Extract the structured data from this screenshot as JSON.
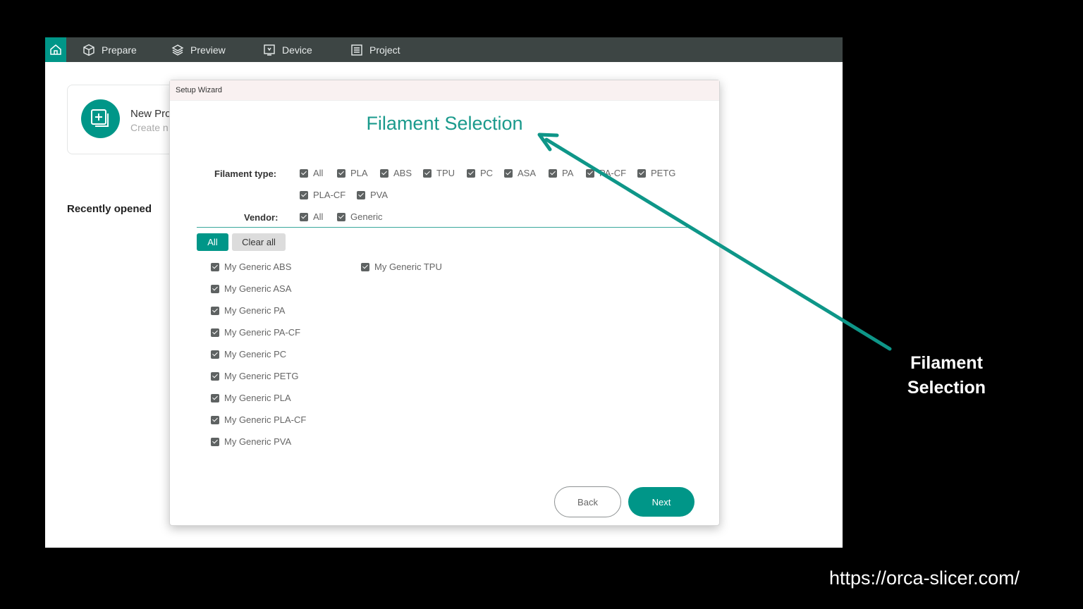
{
  "nav": {
    "tabs": [
      {
        "label": "Prepare",
        "icon": "cube-icon"
      },
      {
        "label": "Preview",
        "icon": "layers-icon"
      },
      {
        "label": "Device",
        "icon": "monitor-icon"
      },
      {
        "label": "Project",
        "icon": "list-icon"
      }
    ]
  },
  "home": {
    "new_project_title": "New Pro",
    "new_project_sub": "Create n",
    "recently_opened": "Recently opened"
  },
  "wizard": {
    "window_title": "Setup Wizard",
    "heading": "Filament Selection",
    "filament_type_label": "Filament type:",
    "filament_types": [
      "All",
      "PLA",
      "ABS",
      "TPU",
      "PC",
      "ASA",
      "PA",
      "PA-CF",
      "PETG",
      "PLA-CF",
      "PVA"
    ],
    "vendor_label": "Vendor:",
    "vendors": [
      "All",
      "Generic"
    ],
    "all_button": "All",
    "clear_all_button": "Clear all",
    "filaments_col1": [
      "My Generic ABS",
      "My Generic ASA",
      "My Generic PA",
      "My Generic PA-CF",
      "My Generic PC",
      "My Generic PETG",
      "My Generic PLA",
      "My Generic PLA-CF",
      "My Generic PVA"
    ],
    "filaments_col2": [
      "My Generic TPU"
    ],
    "back_button": "Back",
    "next_button": "Next"
  },
  "annotation": {
    "line1": "Filament",
    "line2": "Selection",
    "url": "https://orca-slicer.com/"
  },
  "colors": {
    "accent": "#009688",
    "topbar": "#3d4544",
    "arrow": "#0e9688"
  }
}
